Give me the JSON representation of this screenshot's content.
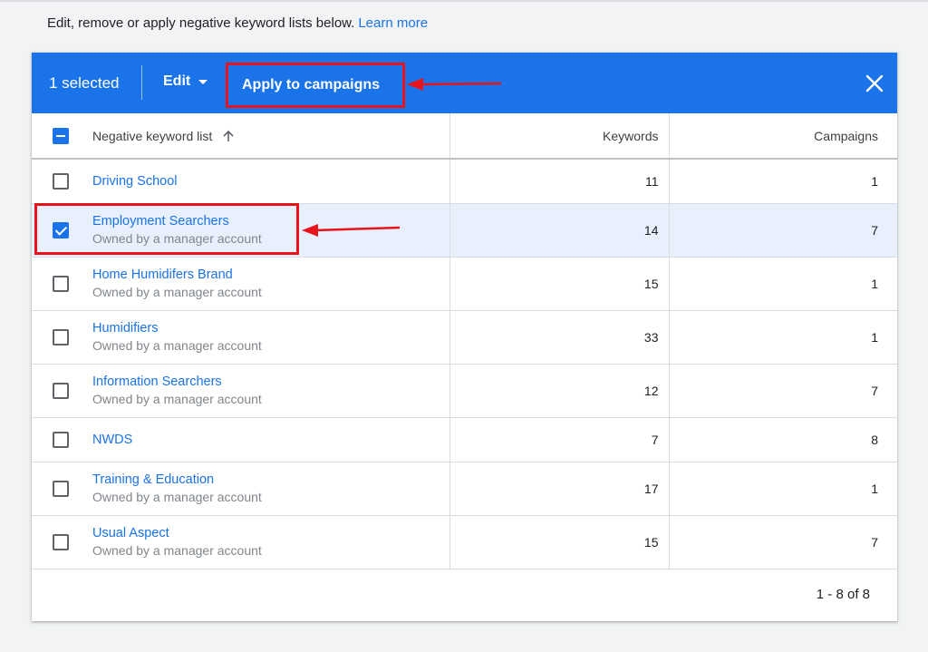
{
  "intro": {
    "text": "Edit, remove or apply negative keyword lists below.",
    "learn_more": "Learn more"
  },
  "actionbar": {
    "selected_count": "1 selected",
    "edit_label": "Edit",
    "apply_label": "Apply to campaigns",
    "accent_color": "#1a73e8"
  },
  "table": {
    "columns": {
      "name": "Negative keyword list",
      "keywords": "Keywords",
      "campaigns": "Campaigns"
    },
    "rows": [
      {
        "name": "Driving School",
        "owner": "",
        "keywords": "11",
        "campaigns": "1",
        "checked": false
      },
      {
        "name": "Employment Searchers",
        "owner": "Owned by a manager account",
        "keywords": "14",
        "campaigns": "7",
        "checked": true
      },
      {
        "name": "Home Humidifers Brand",
        "owner": "Owned by a manager account",
        "keywords": "15",
        "campaigns": "1",
        "checked": false
      },
      {
        "name": "Humidifiers",
        "owner": "Owned by a manager account",
        "keywords": "33",
        "campaigns": "1",
        "checked": false
      },
      {
        "name": "Information Searchers",
        "owner": "Owned by a manager account",
        "keywords": "12",
        "campaigns": "7",
        "checked": false
      },
      {
        "name": "NWDS",
        "owner": "",
        "keywords": "7",
        "campaigns": "8",
        "checked": false
      },
      {
        "name": "Training & Education",
        "owner": "Owned by a manager account",
        "keywords": "17",
        "campaigns": "1",
        "checked": false
      },
      {
        "name": "Usual Aspect",
        "owner": "Owned by a manager account",
        "keywords": "15",
        "campaigns": "7",
        "checked": false
      }
    ]
  },
  "pagination": "1 - 8 of 8",
  "annotation_color": "#e8131b"
}
